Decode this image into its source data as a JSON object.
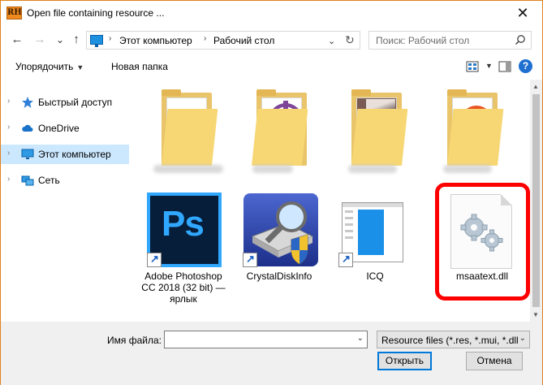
{
  "window": {
    "logo_text": "RH",
    "title": "Open file containing resource ...",
    "close_glyph": "✕"
  },
  "nav": {
    "back_glyph": "←",
    "forward_glyph": "→",
    "recent_glyph": "⌄",
    "up_glyph": "↑",
    "breadcrumb": [
      "Этот компьютер",
      "Рабочий стол"
    ],
    "breadcrumb_sep": "›",
    "search_placeholder": "Поиск: Рабочий стол"
  },
  "toolbar": {
    "organize_label": "Упорядочить",
    "new_folder_label": "Новая папка",
    "help_label": "?"
  },
  "sidebar": {
    "items": [
      {
        "label": "Быстрый доступ",
        "icon": "star-icon",
        "selected": false
      },
      {
        "label": "OneDrive",
        "icon": "cloud-icon",
        "selected": false
      },
      {
        "label": "Этот компьютер",
        "icon": "computer-icon",
        "selected": true
      },
      {
        "label": "Сеть",
        "icon": "network-icon",
        "selected": false
      }
    ]
  },
  "files": [
    {
      "label": "Adobe Photoshop CC 2018 (32 bit) — ярлык",
      "icon": "photoshop-icon",
      "shortcut": true
    },
    {
      "label": "CrystalDiskInfo",
      "icon": "crystaldiskinfo-icon",
      "shortcut": true
    },
    {
      "label": "ICQ",
      "icon": "icq-icon",
      "shortcut": true
    },
    {
      "label": "msaatext.dll",
      "icon": "dll-file-icon",
      "shortcut": false,
      "highlighted": true
    }
  ],
  "footer": {
    "filename_label": "Имя файла:",
    "filename_value": "",
    "filter_value": "Resource files (*.res, *.mui, *.dll",
    "open_label": "Открыть",
    "cancel_label": "Отмена"
  },
  "colors": {
    "selection": "#cce8ff",
    "highlight_border": "#ff0000",
    "accent": "#0078d7"
  }
}
